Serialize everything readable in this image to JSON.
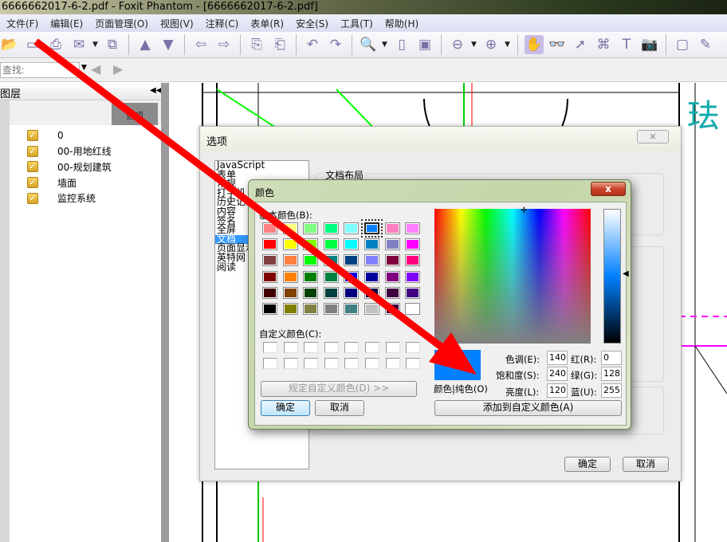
{
  "window": {
    "title": "6666662017-6-2.pdf - Foxit Phantom - [6666662017-6-2.pdf]"
  },
  "menu": [
    "文件(F)",
    "编辑(E)",
    "页面管理(O)",
    "视图(V)",
    "注释(C)",
    "表单(R)",
    "安全(S)",
    "工具(T)",
    "帮助(H)"
  ],
  "toolbar": {
    "icons": [
      "open-icon",
      "save-icon",
      "print-icon",
      "email-icon",
      "scan-icon",
      "prev-page-icon",
      "next-page-icon",
      "back-icon",
      "forward-icon",
      "extract-page-icon",
      "insert-page-icon",
      "undo-icon",
      "redo-icon",
      "zoom-icon",
      "fit-page-icon",
      "fit-width-icon",
      "zoom-out-icon",
      "zoom-in-icon",
      "hand-icon",
      "reading-glasses-icon",
      "select-icon",
      "binoculars-icon",
      "text-select-icon",
      "snapshot-icon",
      "full-screen-icon",
      "typewriter-icon"
    ]
  },
  "findbar": {
    "placeholder": "查找:"
  },
  "layers": {
    "title": "图层",
    "sort_label": "选项",
    "items": [
      "0",
      "00-用地红线",
      "00-规划建筑",
      "墙面",
      "监控系统"
    ]
  },
  "options_dialog": {
    "title": "选项",
    "categories": [
      "JavaScript",
      "表单",
      "常规",
      "打字机",
      "历史记录",
      "内容",
      "签名",
      "全屏",
      "文档",
      "页面显示",
      "英特网",
      "阅读"
    ],
    "selected": "文档",
    "group_title": "文档布局",
    "ok": "确定",
    "cancel": "取消"
  },
  "color_dialog": {
    "title": "颜色",
    "close": "x",
    "basic_label": "基本颜色(B):",
    "basic_colors": [
      "#FF8080",
      "#FFFF80",
      "#80FF80",
      "#00FF80",
      "#80FFFF",
      "#0080FF",
      "#FF80C0",
      "#FF80FF",
      "#FF0000",
      "#FFFF00",
      "#80FF00",
      "#00FF40",
      "#00FFFF",
      "#0080C0",
      "#8080C0",
      "#FF00FF",
      "#804040",
      "#FF8040",
      "#00FF00",
      "#008080",
      "#004080",
      "#8080FF",
      "#800040",
      "#FF0080",
      "#800000",
      "#FF8000",
      "#008000",
      "#008040",
      "#0000FF",
      "#0000A0",
      "#800080",
      "#8000FF",
      "#400000",
      "#804000",
      "#004000",
      "#004040",
      "#000080",
      "#000040",
      "#400040",
      "#400080",
      "#000000",
      "#808000",
      "#808040",
      "#808080",
      "#408080",
      "#C0C0C0",
      "#400040",
      "#FFFFFF"
    ],
    "selected_index": 5,
    "custom_label": "自定义颜色(C):",
    "define_custom": "规定自定义颜色(D) >>",
    "ok": "确定",
    "cancel": "取消",
    "color_solid_label": "颜色|纯色(O)",
    "current_color": "#0080FF",
    "fields": {
      "hue": {
        "label": "色调(E):",
        "value": "140"
      },
      "sat": {
        "label": "饱和度(S):",
        "value": "240"
      },
      "lum": {
        "label": "亮度(L):",
        "value": "120"
      },
      "red": {
        "label": "红(R):",
        "value": "0"
      },
      "green": {
        "label": "绿(G):",
        "value": "128"
      },
      "blue": {
        "label": "蓝(U):",
        "value": "255"
      }
    },
    "add_custom": "添加到自定义颜色(A)"
  }
}
